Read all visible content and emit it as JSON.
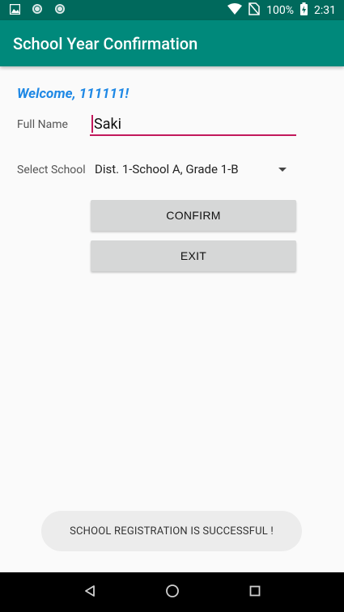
{
  "status_bar": {
    "battery_percent": "100%",
    "time": "2:31",
    "icons": [
      "image-icon",
      "circle-icon",
      "circle-icon",
      "wifi-icon",
      "no-sim-icon",
      "battery-charging-icon"
    ]
  },
  "app_bar": {
    "title": "School Year Confirmation"
  },
  "form": {
    "welcome": "Welcome, 111111!",
    "full_name_label": "Full Name",
    "full_name_value": "Saki",
    "select_school_label": "Select School",
    "selected_school": "Dist. 1-School A, Grade 1-B"
  },
  "buttons": {
    "confirm": "CONFIRM",
    "exit": "EXIT"
  },
  "toast": {
    "message": "SCHOOL REGISTRATION IS SUCCESSFUL !"
  },
  "nav": {
    "icons": [
      "back-icon",
      "home-icon",
      "recents-icon"
    ]
  },
  "colors": {
    "status_bar": "#00695c",
    "app_bar": "#00897b",
    "accent": "#c2185b",
    "welcome": "#1e88e5"
  }
}
